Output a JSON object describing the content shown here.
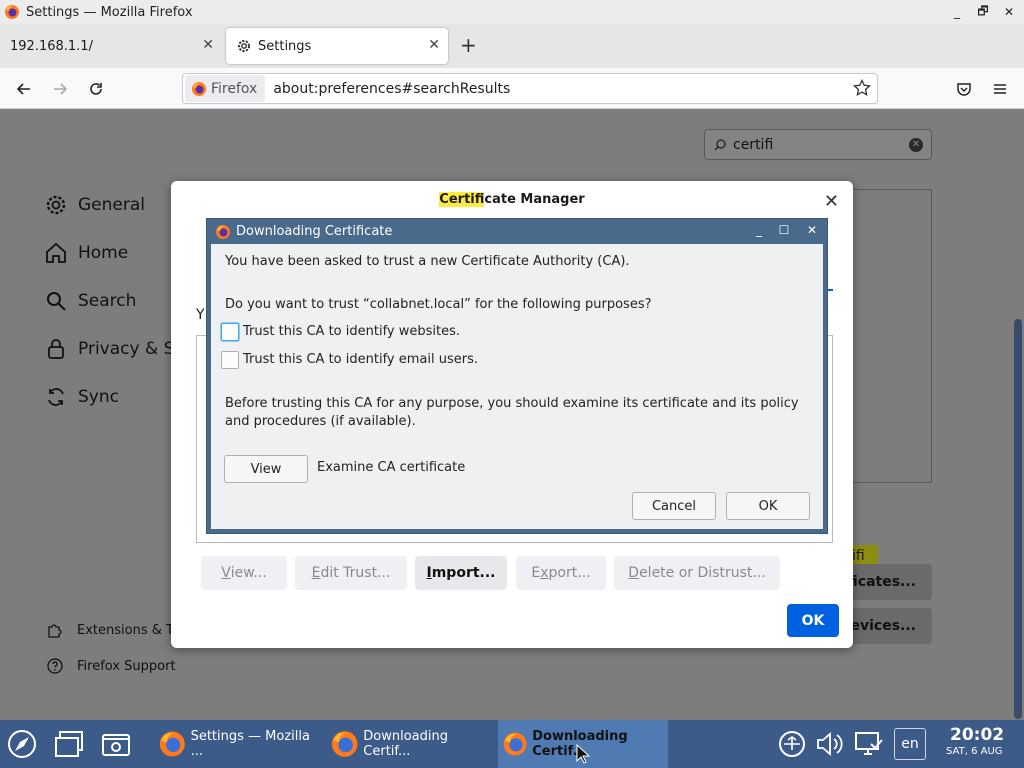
{
  "window": {
    "title": "Settings — Mozilla Firefox",
    "minimize": "_",
    "maximize": "🗗",
    "close": "✕"
  },
  "tabs": [
    {
      "label": "192.168.1.1/",
      "close": "✕",
      "active": false
    },
    {
      "label": "Settings",
      "close": "✕",
      "active": true
    }
  ],
  "newtab": "+",
  "urlbar": {
    "identity_label": "Firefox",
    "url": "about:preferences#searchResults"
  },
  "prefs": {
    "search_value": "certifi",
    "categories": [
      "General",
      "Home",
      "Search",
      "Privacy & Se",
      "Sync"
    ],
    "footer": [
      "Extensions & Th",
      "Firefox Support"
    ],
    "bg_text_y": "Y",
    "bg_hl_text": "ifi",
    "bg_btn_certs": "ficates...",
    "bg_btn_devices": "evices..."
  },
  "cert_manager": {
    "title_highlight": "Certifi",
    "title_rest": "cate Manager",
    "close": "✕",
    "buttons": {
      "view": {
        "ul": "V",
        "rest": "iew..."
      },
      "edit": {
        "ul": "E",
        "rest": "dit Trust..."
      },
      "import": {
        "ul": "I",
        "rest": "mport..."
      },
      "export": {
        "ul": "x",
        "pre": "E",
        "rest": "port..."
      },
      "delete": {
        "ul": "D",
        "rest": "elete or Distrust..."
      }
    },
    "ok": "OK"
  },
  "download_dialog": {
    "title": "Downloading Certificate",
    "intro": "You have been asked to trust a new Certificate Authority (CA).",
    "question": "Do you want to trust “collabnet.local” for the following purposes?",
    "options": [
      {
        "label": "Trust this CA to identify websites.",
        "checked": false,
        "focused": true
      },
      {
        "label": "Trust this CA to identify email users.",
        "checked": false,
        "focused": false
      }
    ],
    "advice": "Before trusting this CA for any purpose, you should examine its certificate and its policy and procedures (if available).",
    "view_button": "View",
    "view_label": "Examine CA certificate",
    "cancel": "Cancel",
    "ok": "OK"
  },
  "taskbar": {
    "tasks": [
      {
        "label": "Settings — Mozilla ..."
      },
      {
        "label": "Downloading Certif..."
      },
      {
        "label": "Downloading Certif..."
      }
    ],
    "lang": "en",
    "time": "20:02",
    "date": "SAT, 6 AUG"
  },
  "colors": {
    "accent": "#0061e0",
    "taskbar": "#3c5b88",
    "dialog_frame": "#4a6a8c",
    "highlight": "#ffeb3b"
  }
}
